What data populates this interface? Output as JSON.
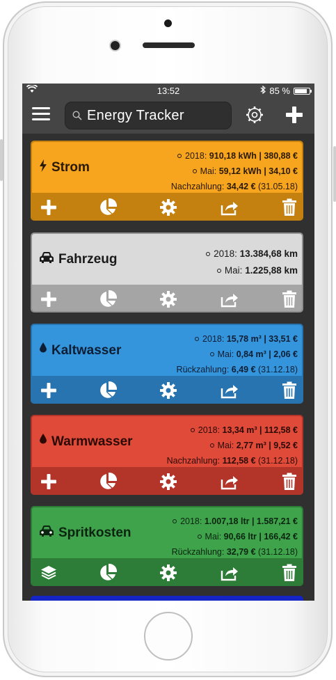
{
  "status": {
    "time": "13:52",
    "battery": "85 %",
    "battery_level": 0.85
  },
  "nav": {
    "search_value": "Energy  Tracker"
  },
  "cards": [
    {
      "name": "Strom",
      "icon": "bolt-icon",
      "top_color": "#f7a41e",
      "bar_color": "#c4810f",
      "text_color": "#2a1a00",
      "rows": [
        [
          "2018:",
          "910,18 kWh | 380,88 €"
        ],
        [
          "Mai:",
          "59,12 kWh | 34,10 €"
        ]
      ],
      "summary": {
        "label": "Nachzahlung:",
        "value": "34,42 €",
        "date": "(31.05.18)"
      },
      "first_action": "plus"
    },
    {
      "name": "Fahrzeug",
      "icon": "car-icon",
      "top_color": "#dadada",
      "bar_color": "#a5a5a5",
      "text_color": "#1a1a1a",
      "rows": [
        [
          "2018:",
          "13.384,68 km"
        ],
        [
          "Mai:",
          "1.225,88 km"
        ]
      ],
      "summary": null,
      "first_action": "plus"
    },
    {
      "name": "Kaltwasser",
      "icon": "drop-icon",
      "top_color": "#3595dc",
      "bar_color": "#2874b0",
      "text_color": "#0d1d33",
      "rows": [
        [
          "2018:",
          "15,78 m³ | 33,51 €"
        ],
        [
          "Mai:",
          "0,84 m³ | 2,06 €"
        ]
      ],
      "summary": {
        "label": "Rückzahlung:",
        "value": "6,49 €",
        "date": "(31.12.18)"
      },
      "first_action": "plus"
    },
    {
      "name": "Warmwasser",
      "icon": "drop-icon",
      "top_color": "#e04a38",
      "bar_color": "#b3352a",
      "text_color": "#2b0a06",
      "rows": [
        [
          "2018:",
          "13,34 m³ | 112,58 €"
        ],
        [
          "Mai:",
          "2,77 m³ | 9,52 €"
        ]
      ],
      "summary": {
        "label": "Nachzahlung:",
        "value": "112,58 €",
        "date": "(31.12.18)"
      },
      "first_action": "plus"
    },
    {
      "name": "Spritkosten",
      "icon": "car-icon",
      "top_color": "#3ea34b",
      "bar_color": "#2d7c37",
      "text_color": "#0b2410",
      "rows": [
        [
          "2018:",
          "1.007,18 ltr | 1.587,21 €"
        ],
        [
          "Mai:",
          "90,66 ltr | 166,42 €"
        ]
      ],
      "summary": {
        "label": "Rückzahlung:",
        "value": "32,79 €",
        "date": "(31.12.18)"
      },
      "first_action": "layers"
    }
  ],
  "action_icons": [
    "pie-chart-icon",
    "gear-icon",
    "share-icon",
    "trash-icon"
  ]
}
